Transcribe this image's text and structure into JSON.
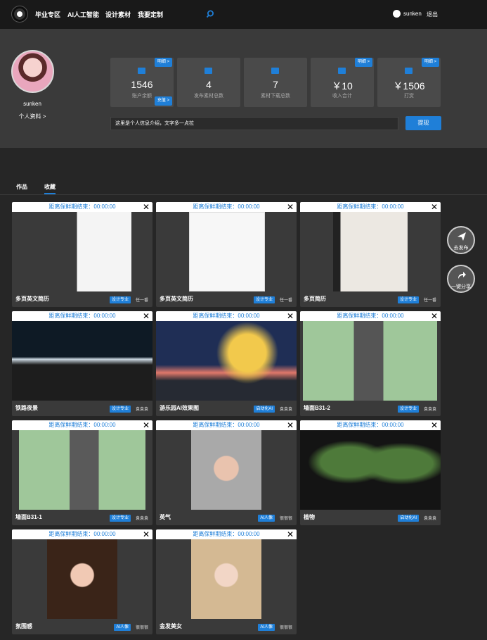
{
  "nav": {
    "items": [
      "毕业专区",
      "AI人工智能",
      "设计素材",
      "我要定制"
    ],
    "user": "sunken",
    "logout": "退出"
  },
  "profile": {
    "name": "sunken",
    "link": "个人资料 >"
  },
  "stats": [
    {
      "value": "1546",
      "label": "账户余额",
      "badge_top": "明细 >",
      "badge_bottom": "充值 >"
    },
    {
      "value": "4",
      "label": "发布素材总数"
    },
    {
      "value": "7",
      "label": "素材下载总数"
    },
    {
      "value": "￥10",
      "label": "收入合计",
      "badge_top": "明细 >"
    },
    {
      "value": "￥1506",
      "label": "打赏",
      "badge_top": "明细 >"
    }
  ],
  "intro": "这里是个人信息介绍，文字多一点拉",
  "withdraw": "提现",
  "tabs": [
    "作品",
    "收藏"
  ],
  "card_header": "距离保鲜期结束：00:00:00",
  "cards": [
    {
      "title": "多页英文简历",
      "tag": "设计专业",
      "user": "任一番"
    },
    {
      "title": "多页英文简历",
      "tag": "设计专业",
      "user": "任一番"
    },
    {
      "title": "多页简历",
      "tag": "设计专业",
      "user": "任一番"
    },
    {
      "title": "铁路夜景",
      "tag": "设计专业",
      "user": "袁袁袁"
    },
    {
      "title": "游乐园AI效果图",
      "tag": "启动化AI",
      "user": "袁袁袁"
    },
    {
      "title": "墙面B31-2",
      "tag": "设计专业",
      "user": "袁袁袁"
    },
    {
      "title": "墙面B31-1",
      "tag": "设计专业",
      "user": "袁袁袁"
    },
    {
      "title": "英气",
      "tag": "AI人像",
      "user": "很很很"
    },
    {
      "title": "植物",
      "tag": "启动化AI",
      "user": "袁袁袁"
    },
    {
      "title": "氛围感",
      "tag": "AI人像",
      "user": "很很很"
    },
    {
      "title": "金发美女",
      "tag": "AI人像",
      "user": "很很很"
    }
  ],
  "floats": {
    "publish": "去发布",
    "share": "一键分享"
  }
}
